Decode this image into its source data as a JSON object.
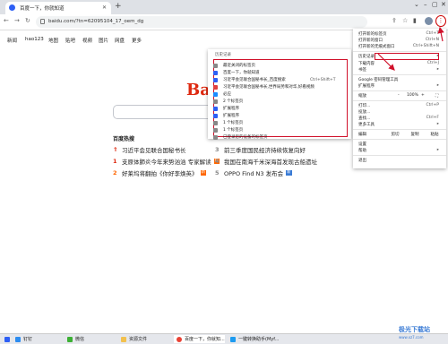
{
  "browser": {
    "tab_title": "百度一下，你就知道",
    "new_tab": "+",
    "url": "baidu.com/?tn=62095104_17_oem_dg",
    "back": "←",
    "forward": "→",
    "reload": "↻",
    "menu_icon": "⋮"
  },
  "baidu_nav": [
    "新闻",
    "hao123",
    "地图",
    "贴吧",
    "视频",
    "图片",
    "网盘",
    "更多"
  ],
  "logo": "Bai",
  "hot": {
    "title": "百度热搜",
    "items": [
      {
        "rank": "",
        "text": "习近平会见联合国秘书长",
        "badge": ""
      },
      {
        "rank": "3",
        "text": "前三季度国民经济持续恢复向好",
        "badge": ""
      },
      {
        "rank": "1",
        "text": "支原体肺炎今年来势汹汹 专家解读",
        "badge": "热"
      },
      {
        "rank": "4",
        "text": "我国在南海千米深海首发现古船遗址",
        "badge": ""
      },
      {
        "rank": "2",
        "text": "好莱坞将翻拍《你好李焕英》",
        "badge": "新"
      },
      {
        "rank": "5",
        "text": "OPPO Find N3 发布会",
        "badge": "新"
      }
    ]
  },
  "history_submenu": {
    "title": "历史记录",
    "rows": [
      {
        "text": "最近关闭的标签页",
        "shortcut": "",
        "color": "#888"
      },
      {
        "text": "百度一下，你就知道",
        "shortcut": "",
        "color": "#2d5ff5"
      },
      {
        "text": "习近平会见联合国秘书长_百度搜索",
        "shortcut": "Ctrl+Shift+T",
        "color": "#2d5ff5"
      },
      {
        "text": "习近平会见联合国秘书长,世界局势和对华,好看视频",
        "shortcut": "",
        "color": "#e04040"
      },
      {
        "text": "必应",
        "shortcut": "",
        "color": "#1a8cff"
      },
      {
        "text": "2 个标签页",
        "shortcut": "",
        "color": "#888"
      },
      {
        "text": "扩展程序",
        "shortcut": "",
        "color": "#2d5ff5"
      },
      {
        "text": "扩展程序",
        "shortcut": "",
        "color": "#2d5ff5"
      },
      {
        "text": "1 个标签页",
        "shortcut": "",
        "color": "#888"
      },
      {
        "text": "1 个标签页",
        "shortcut": "",
        "color": "#888"
      },
      {
        "text": "已登录您的设备的标签页",
        "shortcut": "",
        "color": "#888"
      }
    ]
  },
  "chrome_menu": {
    "new_tab": "打开新的标签页",
    "new_tab_sc": "Ctrl+T",
    "new_window": "打开新的窗口",
    "new_window_sc": "Ctrl+N",
    "incognito": "打开新的无痕式窗口",
    "incognito_sc": "Ctrl+Shift+N",
    "history": "历史记录",
    "downloads": "下载内容",
    "downloads_sc": "Ctrl+J",
    "bookmarks": "书签",
    "google_pw": "Google 密码管理工具",
    "extensions": "扩展程序",
    "zoom_label": "缩放",
    "zoom_minus": "-",
    "zoom_value": "100%",
    "zoom_plus": "+",
    "print": "打印...",
    "print_sc": "Ctrl+P",
    "cast": "投放...",
    "find": "查找...",
    "find_sc": "Ctrl+F",
    "more_tools": "更多工具",
    "edit": "编辑",
    "cut": "剪切",
    "copy": "复制",
    "paste": "粘贴",
    "settings": "设置",
    "help": "帮助",
    "exit": "退出"
  },
  "taskbar": {
    "items": [
      "钉钉",
      "微信",
      "资源文件",
      "百度一下，你就知...",
      "一键转换助手(Myf..."
    ]
  },
  "watermark": "极光下载站",
  "watermark_url": "www.xz7.com"
}
